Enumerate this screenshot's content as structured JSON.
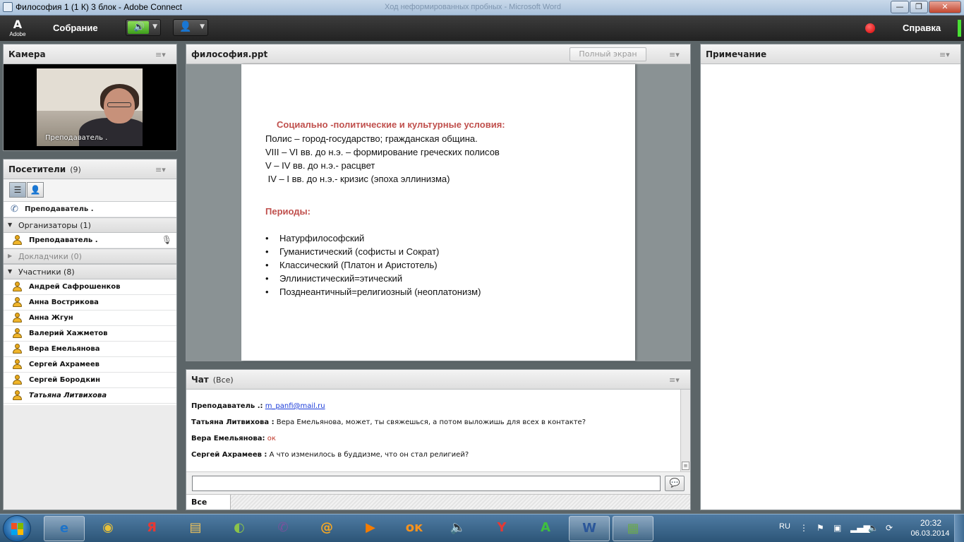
{
  "window": {
    "title": "Философия 1 (1 К) 3 блок - Adobe Connect",
    "ghost_title": "Ход неформированных пробных - Microsoft Word",
    "min_label": "—",
    "max_label": "❐",
    "close_label": "✕"
  },
  "menubar": {
    "logo_glyph": "A",
    "logo_text": "Adobe",
    "meeting_label": "Собрание",
    "help_label": "Справка",
    "speaker_icon": "🔊",
    "camera_icon": "👤",
    "drop_glyph": "▼"
  },
  "camera_pod": {
    "title": "Камера",
    "video_label": "Преподаватель ."
  },
  "attendees_pod": {
    "title": "Посетители",
    "count": "(9)",
    "phone_user": "Преподаватель .",
    "groups": {
      "hosts": "Организаторы (1)",
      "presenters": "Докладчики (0)",
      "participants": "Участники (8)"
    },
    "host_name": "Преподаватель .",
    "participants": [
      "Андрей Сафрошенков",
      "Анна Вострикова",
      "Анна Жгун",
      "Валерий Хажметов",
      "Вера Емельянова",
      "Сергей Ахрамеев",
      "Сергей Бородкин",
      "Татьяна Литвихова"
    ]
  },
  "share_pod": {
    "title": "философия.ppt",
    "fullscreen_label": "Полный экран",
    "slide": {
      "heading": "Социально -политические и культурные условия:",
      "lines": [
        "Полис – город-государство; гражданская община.",
        "VIII – VI вв. до н.э. – формирование греческих полисов",
        "V – IV вв. до н.э.- расцвет",
        " IV – I вв. до н.э.- кризис (эпоха эллинизма)"
      ],
      "subheading": "Периоды:",
      "bullet_glyph": "•",
      "bullets": [
        "Натурфилософский",
        "Гуманистический (софисты и Сократ)",
        "Классический (Платон и Аристотель)",
        "Эллинистический=этический",
        "Позднеантичный=религиозный (неоплатонизм)"
      ]
    }
  },
  "chat_pod": {
    "title": "Чат",
    "scope": "(Все)",
    "messages": [
      {
        "who": "Преподаватель .:",
        "text": "m_panfi@mail.ru"
      },
      {
        "who": "Татьяна Литвихова :",
        "text": "Вера Емельянова, может, ты свяжешься, а потом выложишь для всех в контакте?"
      },
      {
        "who": "Вера Емельянова:",
        "text": "ок"
      },
      {
        "who": "Сергей Ахрамеев :",
        "text": "А что изменилось в буддизме, что он стал религией?"
      }
    ],
    "input_value": "",
    "tab_label": "Все"
  },
  "notes_pod": {
    "title": "Примечание"
  },
  "taskbar": {
    "apps": [
      {
        "name": "ie",
        "glyph": "e",
        "color": "#1e73c8"
      },
      {
        "name": "chrome",
        "glyph": "◉",
        "color": "#e9c23a"
      },
      {
        "name": "yandex",
        "glyph": "Я",
        "color": "#e53935"
      },
      {
        "name": "explorer",
        "glyph": "▤",
        "color": "#f2c45a"
      },
      {
        "name": "game",
        "glyph": "◐",
        "color": "#8bc34a"
      },
      {
        "name": "viber",
        "glyph": "✆",
        "color": "#7b519d"
      },
      {
        "name": "mail",
        "glyph": "@",
        "color": "#f5a623"
      },
      {
        "name": "video",
        "glyph": "▶",
        "color": "#f57c00"
      },
      {
        "name": "odnoklassniki",
        "glyph": "ок",
        "color": "#f7931e"
      },
      {
        "name": "audio",
        "glyph": "🔈",
        "color": "#5aa0e0"
      },
      {
        "name": "yandex-browser",
        "glyph": "Y",
        "color": "#e53935"
      },
      {
        "name": "a-app",
        "glyph": "A",
        "color": "#3fbf3f"
      },
      {
        "name": "word",
        "glyph": "W",
        "color": "#2b579a"
      },
      {
        "name": "connect",
        "glyph": "▦",
        "color": "#6aa84f"
      }
    ],
    "lang": "RU",
    "time": "20:32",
    "date": "06.03.2014"
  }
}
